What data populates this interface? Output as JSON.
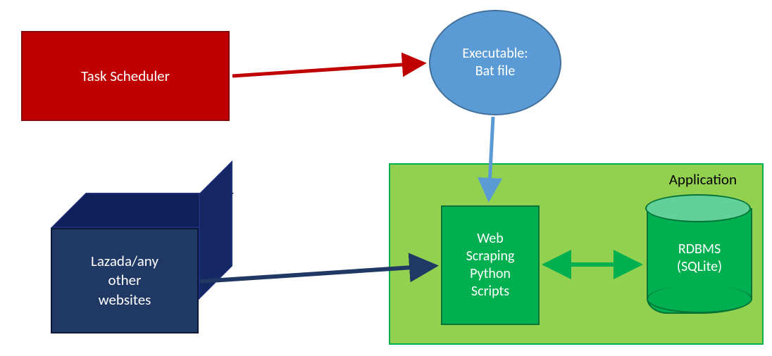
{
  "diagram": {
    "nodes": {
      "task_scheduler": {
        "label": "Task Scheduler",
        "shape": "rectangle",
        "fill": "#c00000",
        "stroke": "#860b0b"
      },
      "executable": {
        "label_line1": "Executable:",
        "label_line2": "Bat file",
        "shape": "ellipse",
        "fill": "#5b9bd5",
        "stroke": "#41719c"
      },
      "application": {
        "label": "Application",
        "shape": "group-rectangle",
        "fill": "#92d050",
        "stroke": "#00b050"
      },
      "scraping": {
        "label_line1": "Web",
        "label_line2": "Scraping",
        "label_line3": "Python",
        "label_line4": "Scripts",
        "shape": "rectangle",
        "fill": "#00b050",
        "stroke": "#047436"
      },
      "rdbms": {
        "label_line1": "RDBMS",
        "label_line2": "(SQLite)",
        "shape": "cylinder",
        "fill": "#00b050",
        "top_fill": "#61d199",
        "stroke": "#047436"
      },
      "websites": {
        "label_line1": "Lazada/any",
        "label_line2": "other",
        "label_line3": "websites",
        "shape": "cube",
        "fill": "#203864",
        "stroke": "#0d1838"
      }
    },
    "edges": [
      {
        "from": "task_scheduler",
        "to": "executable",
        "color": "#c00000",
        "style": "arrow",
        "dir": "one"
      },
      {
        "from": "executable",
        "to": "scraping",
        "color": "#5b9bd5",
        "style": "arrow",
        "dir": "one"
      },
      {
        "from": "websites",
        "to": "scraping",
        "color": "#203864",
        "style": "arrow",
        "dir": "one"
      },
      {
        "from": "scraping",
        "to": "rdbms",
        "color": "#00b050",
        "style": "double-arrow",
        "dir": "both"
      }
    ]
  }
}
